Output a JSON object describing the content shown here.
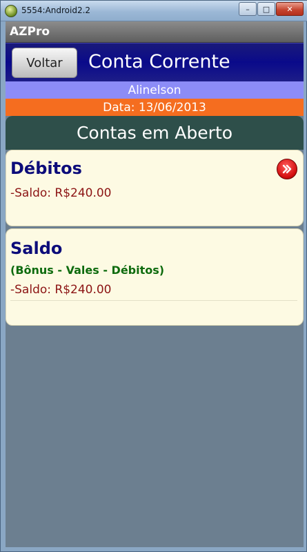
{
  "window": {
    "title": "5554:Android2.2",
    "minimize_glyph": "–",
    "maximize_glyph": "□",
    "close_glyph": "✕"
  },
  "app": {
    "title": "AZPro"
  },
  "header": {
    "back_label": "Voltar",
    "title": "Conta Corrente"
  },
  "user": {
    "name": "Alinelson"
  },
  "date_line": "Data: 13/06/2013",
  "section": {
    "title": "Contas em Aberto"
  },
  "cards": {
    "debitos": {
      "title": "Débitos",
      "amount": "-Saldo: R$240.00",
      "icon": "double-chevron-right-icon"
    },
    "saldo": {
      "title": "Saldo",
      "subtitle": "(Bônus - Vales - Débitos)",
      "amount": "-Saldo: R$240.00"
    }
  },
  "colors": {
    "header_bg": "#0a0a8a",
    "user_bar": "#8c8cf7",
    "date_bar": "#f56d1f",
    "section_head": "#2e4f4a",
    "card_bg": "#fdfae3",
    "card_title": "#0c0c7a",
    "amount": "#8c1414",
    "subtitle": "#0e6b0e",
    "screen_bg": "#6c7f90"
  }
}
